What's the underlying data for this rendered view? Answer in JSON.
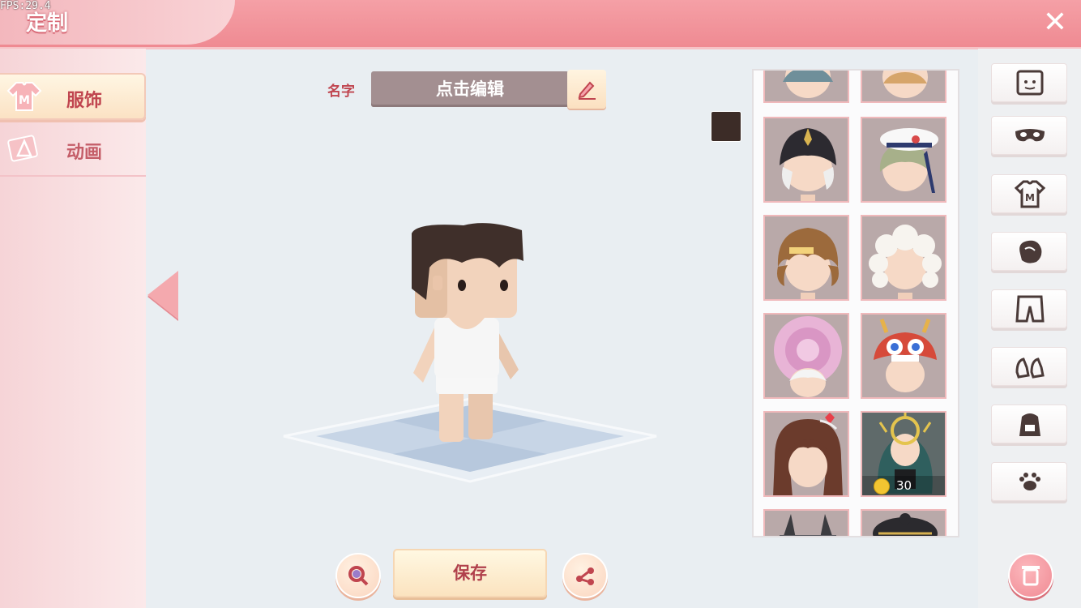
{
  "fps": "FPS:29.4",
  "header": {
    "title": "定制",
    "close_label": "✕"
  },
  "sidebar": {
    "tabs": [
      {
        "label": "服饰",
        "icon": "shirt-icon",
        "active": true
      },
      {
        "label": "动画",
        "icon": "animation-icon",
        "active": false
      }
    ]
  },
  "name": {
    "label": "名字",
    "value": "点击编辑"
  },
  "color_swatch": "#3c2c27",
  "items": [
    {
      "kind": "hair-partial",
      "price": ""
    },
    {
      "kind": "hair-partial",
      "price": ""
    },
    {
      "kind": "black-cap-hair",
      "price": ""
    },
    {
      "kind": "sailor-beret-hair",
      "price": ""
    },
    {
      "kind": "brown-curly-hair",
      "price": ""
    },
    {
      "kind": "white-curly-hair",
      "price": ""
    },
    {
      "kind": "pink-rose-hat",
      "price": ""
    },
    {
      "kind": "lion-dance-hat",
      "price": ""
    },
    {
      "kind": "brown-pigtail-hair",
      "price": ""
    },
    {
      "kind": "teal-crown-hair",
      "price": "30"
    },
    {
      "kind": "horned-hat",
      "price": ""
    },
    {
      "kind": "dark-hat",
      "price": ""
    }
  ],
  "categories": [
    {
      "icon": "face-icon"
    },
    {
      "icon": "mask-icon"
    },
    {
      "icon": "shirt-m-icon"
    },
    {
      "icon": "glove-icon"
    },
    {
      "icon": "pants-icon"
    },
    {
      "icon": "shoes-icon"
    },
    {
      "icon": "backpack-icon"
    },
    {
      "icon": "paw-icon"
    }
  ],
  "actions": {
    "save_label": "保存"
  }
}
